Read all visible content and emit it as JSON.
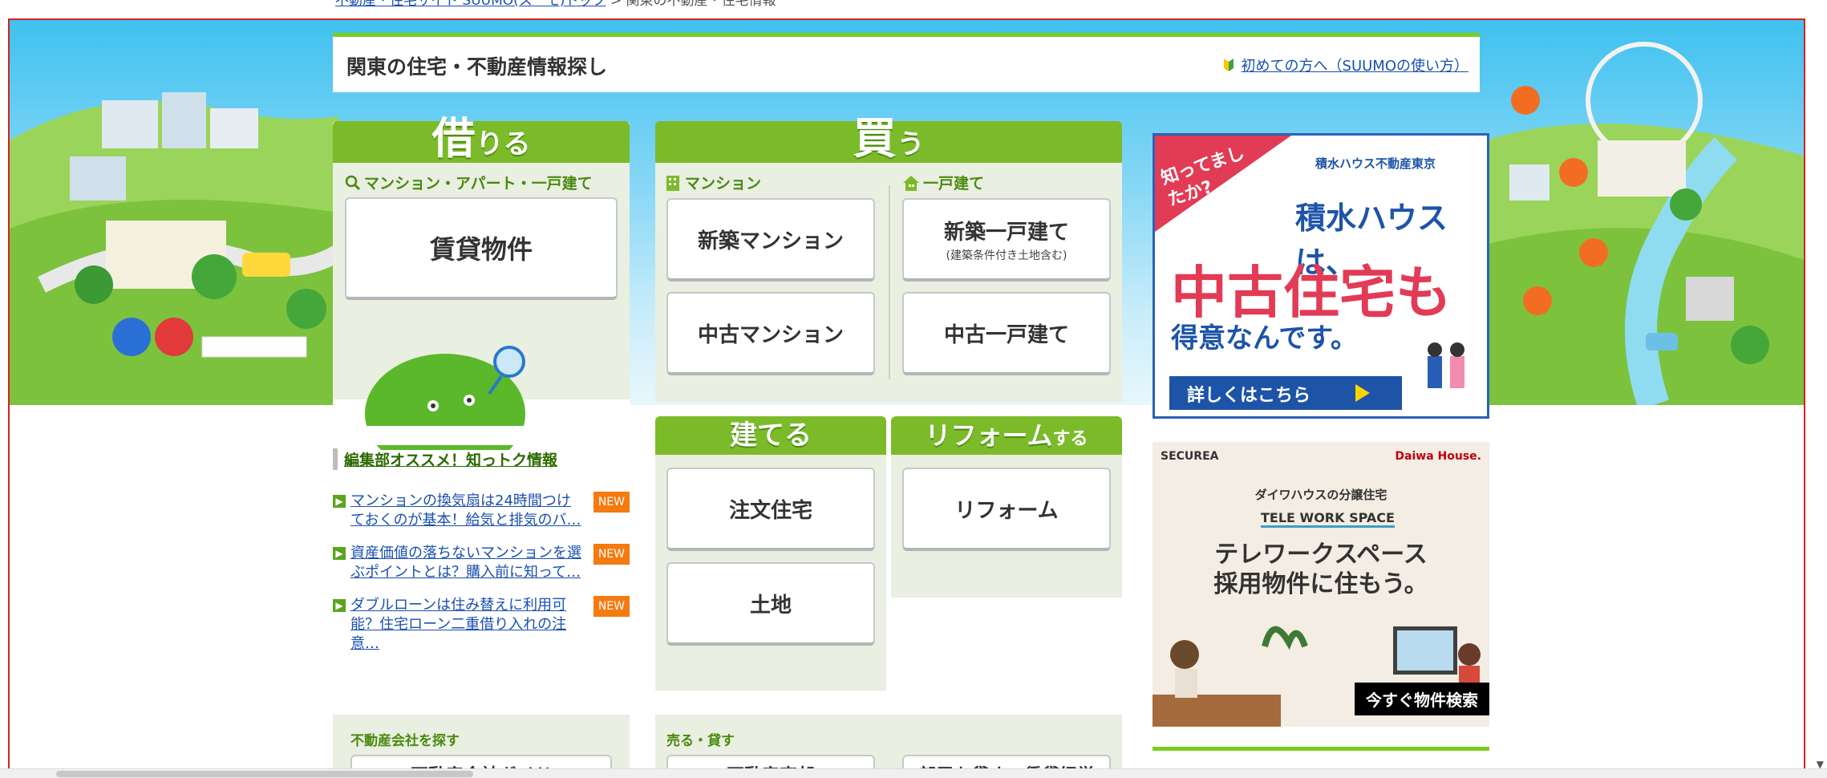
{
  "breadcrumb": {
    "link": "不動産・住宅サイト SUUMO(スーモ)トップ",
    "separator": " > ",
    "current": "関東の不動産・住宅情報"
  },
  "header": {
    "title": "関東の住宅・不動産情報探し",
    "help_link": "初めての方へ（SUUMOの使い方）"
  },
  "rent": {
    "tab_big": "借",
    "tab_small": "りる",
    "sub_label": "マンション・アパート・一戸建て",
    "button": "賃貸物件"
  },
  "buy": {
    "tab_big": "買",
    "tab_small": "う",
    "mansion_label": "マンション",
    "house_label": "一戸建て",
    "buttons": [
      {
        "label": "新築マンション"
      },
      {
        "label": "新築一戸建て",
        "note": "(建築条件付き土地含む)"
      },
      {
        "label": "中古マンション"
      },
      {
        "label": "中古一戸建て"
      }
    ]
  },
  "build": {
    "tab": "建てる",
    "buttons": [
      {
        "label": "注文住宅"
      },
      {
        "label": "土地"
      }
    ]
  },
  "reform": {
    "tab_big": "リフォーム",
    "tab_small": "する",
    "button": "リフォーム"
  },
  "news": {
    "heading": "編集部オススメ！知っトク情報",
    "items": [
      {
        "text": "マンションの換気扇は24時間つけておくのが基本！給気と排気のバ…",
        "badge": "NEW"
      },
      {
        "text": "資産価値の落ちないマンションを選ぶポイントとは？購入前に知って…",
        "badge": "NEW"
      },
      {
        "text": "ダブルローンは住み替えに利用可能？住宅ローン二重借り入れの注意…",
        "badge": "NEW"
      }
    ]
  },
  "ads": {
    "sekisui": {
      "tag": "知ってましたか?",
      "brand": "積水ハウス不動産東京",
      "headline1": "積水ハウスは、",
      "headline2": "中古住宅も",
      "headline3": "得意なんです。",
      "cta": "詳しくはこちら"
    },
    "daiwa": {
      "brand_left": "SECUREA",
      "brand_right": "Daiwa House.",
      "subtitle": "ダイワハウスの分譲住宅",
      "badge": "TELE WORK SPACE",
      "headline1": "テレワークスペース",
      "headline2": "採用物件に住もう。",
      "cta": "今すぐ物件検索"
    }
  },
  "bottom": {
    "agent": {
      "label": "不動産会社を探す",
      "button": "不動産会社ガイド"
    },
    "sell": {
      "label": "売る・貸す",
      "buttons": [
        "不動産売却",
        "部屋を貸す・賃貸経営"
      ]
    }
  }
}
